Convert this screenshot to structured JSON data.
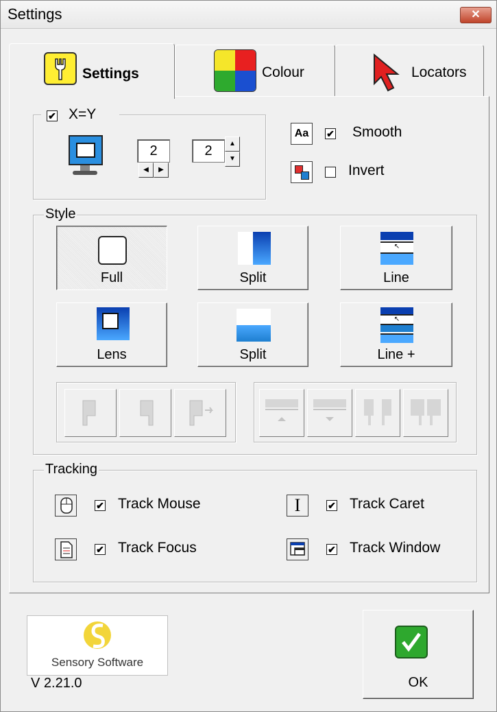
{
  "window": {
    "title": "Settings",
    "close_label": "✕"
  },
  "tabs": [
    {
      "label": "Settings",
      "icon": "wrench-icon",
      "active": true
    },
    {
      "label": "Colour",
      "icon": "colour-icon",
      "active": false
    },
    {
      "label": "Locators",
      "icon": "arrow-cursor-icon",
      "active": false
    }
  ],
  "zoom": {
    "xy_label": "X=Y",
    "xy_checked": true,
    "x_value": "2",
    "y_value": "2"
  },
  "options": {
    "smooth_label": "Smooth",
    "smooth_checked": true,
    "invert_label": "Invert",
    "invert_checked": false
  },
  "style": {
    "legend": "Style",
    "buttons": [
      {
        "label": "Full",
        "pressed": true
      },
      {
        "label": "Split",
        "pressed": false
      },
      {
        "label": "Line",
        "pressed": false
      },
      {
        "label": "Lens",
        "pressed": false
      },
      {
        "label": "Split",
        "pressed": false
      },
      {
        "label": "Line +",
        "pressed": false
      }
    ]
  },
  "tracking": {
    "legend": "Tracking",
    "mouse_label": "Track Mouse",
    "mouse_checked": true,
    "caret_label": "Track Caret",
    "caret_checked": true,
    "focus_label": "Track Focus",
    "focus_checked": true,
    "window_label": "Track Window",
    "window_checked": true
  },
  "footer": {
    "brand": "Sensory Software",
    "version": "V 2.21.0",
    "ok_label": "OK"
  },
  "colors": {
    "lens_blue": "#1e7fd0",
    "ok_green": "#2ea82e",
    "locator_red": "#e02020",
    "icon_yellow": "#ffee33"
  }
}
